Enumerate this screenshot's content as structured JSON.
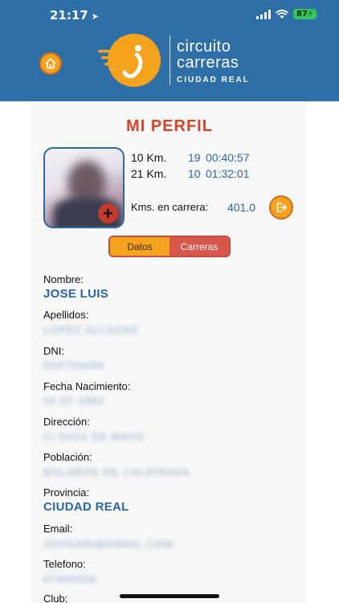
{
  "status_bar": {
    "time": "21:17",
    "battery": "87"
  },
  "brand": {
    "line1": "circuito",
    "line2": "carreras",
    "subtitle": "CIUDAD REAL"
  },
  "page": {
    "title": "MI PERFIL"
  },
  "stats": [
    {
      "label": "10 Km.",
      "count": "19",
      "time": "00:40:57"
    },
    {
      "label": "21 Km.",
      "count": "10",
      "time": "01:32:01"
    }
  ],
  "kms": {
    "label": "Kms. en carrera:",
    "value": "401.0"
  },
  "tabs": [
    {
      "label": "Datos",
      "active": true
    },
    {
      "label": "Carreras",
      "active": false
    }
  ],
  "fields": [
    {
      "label": "Nombre:",
      "value": "JOSE LUIS",
      "blurred": false
    },
    {
      "label": "Apellidos:",
      "value": "LOPEZ ALCAZAR",
      "blurred": true
    },
    {
      "label": "DNI:",
      "value": "05475643H",
      "blurred": true
    },
    {
      "label": "Fecha Nacimiento:",
      "value": "02-07-1982",
      "blurred": true
    },
    {
      "label": "Dirección:",
      "value": "C/ DIOS DE MAYO",
      "blurred": true
    },
    {
      "label": "Población:",
      "value": "BOLAÑOS DE CALATRAVA",
      "blurred": true
    },
    {
      "label": "Provincia:",
      "value": "CIUDAD REAL",
      "blurred": false
    },
    {
      "label": "Email:",
      "value": "JOVGANI@GMAIL.COM",
      "blurred": true
    },
    {
      "label": "Telefono:",
      "value": "67995058",
      "blurred": true
    },
    {
      "label": "Club:",
      "value": "",
      "blurred": false
    }
  ],
  "colors": {
    "header": "#2e6fa8",
    "accent": "#f5a21c",
    "title": "#d9412b",
    "value": "#2a66a8"
  },
  "icons": [
    "location-arrow-icon",
    "signal-icon",
    "wifi-icon",
    "home-icon",
    "add-photo-icon",
    "logout-icon"
  ]
}
